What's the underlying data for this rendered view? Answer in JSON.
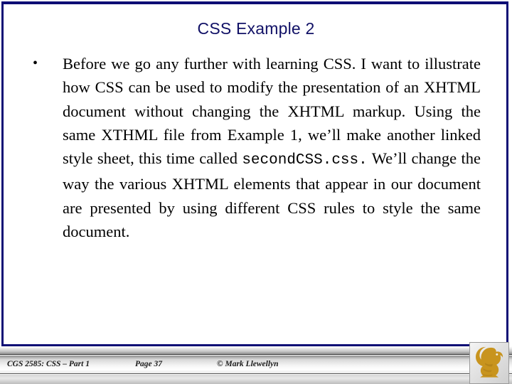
{
  "slide": {
    "title": "CSS Example 2",
    "title_color": "#111166",
    "border_color": "#0d0d75",
    "background": "#ffffff"
  },
  "content": {
    "bullet_marker": "•",
    "paragraph_parts": [
      {
        "type": "text",
        "value": "Before we go any further with learning CSS. I want to illustrate how CSS can be used to modify the presentation of an XHTML document without changing the XHTML markup. Using the same XTHML file from Example 1, we’ll make another linked style sheet, this time called "
      },
      {
        "type": "code",
        "value": "secondCSS.css."
      },
      {
        "type": "text",
        "value": "  We’ll change the way the various XHTML elements that appear in our document are presented by using different CSS rules to style the same document."
      }
    ],
    "paragraph_plain": "Before we go any further with learning CSS. I want to illustrate how CSS can be used to modify the presentation of an XHTML document without changing the XHTML markup. Using the same XTHML file from Example 1, we’ll make another linked style sheet, this time called secondCSS.css.  We’ll change the way the various XHTML elements that appear in our document are presented by using different CSS rules to style the same document."
  },
  "footer": {
    "course": "CGS 2585: CSS – Part 1",
    "page": "Page 37",
    "copyright": "© Mark Llewellyn",
    "logo_name": "ucf-pegasus-logo",
    "logo_color": "#C8941E"
  }
}
